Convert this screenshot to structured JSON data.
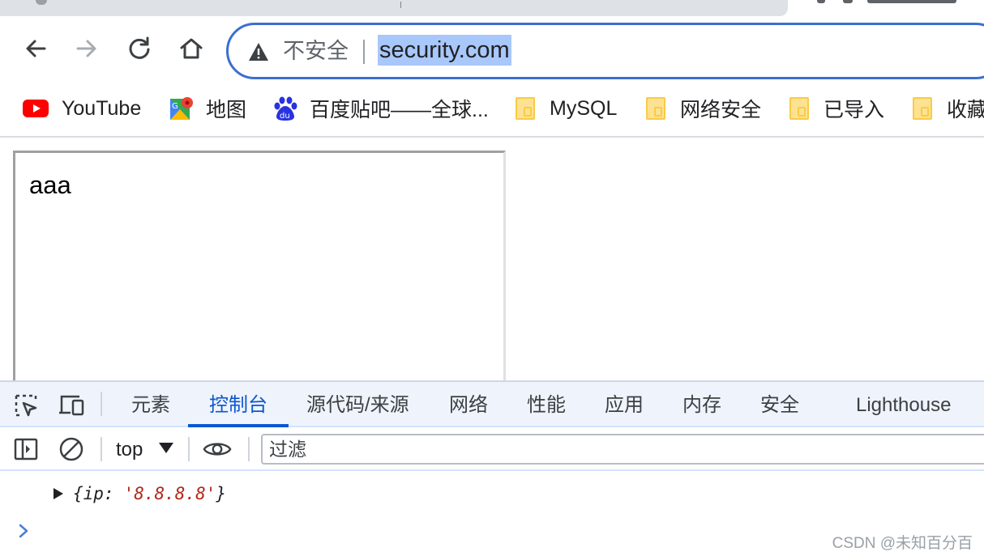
{
  "browser": {
    "address_bar": {
      "security_label": "不安全",
      "url": "security.com"
    },
    "bookmarks": [
      {
        "label": "YouTube",
        "icon": "youtube-icon"
      },
      {
        "label": "地图",
        "icon": "maps-icon"
      },
      {
        "label": "百度贴吧——全球...",
        "icon": "baidu-icon"
      },
      {
        "label": "MySQL",
        "icon": "folder-icon"
      },
      {
        "label": "网络安全",
        "icon": "folder-icon"
      },
      {
        "label": "已导入",
        "icon": "folder-icon"
      },
      {
        "label": "收藏",
        "icon": "folder-icon"
      }
    ]
  },
  "page": {
    "textarea_text": "aaa"
  },
  "devtools": {
    "tabs": [
      {
        "label": "元素"
      },
      {
        "label": "控制台",
        "active": true
      },
      {
        "label": "源代码/来源"
      },
      {
        "label": "网络"
      },
      {
        "label": "性能"
      },
      {
        "label": "应用"
      },
      {
        "label": "内存"
      },
      {
        "label": "安全"
      },
      {
        "label": "Lighthouse"
      }
    ],
    "console_toolbar": {
      "context": "top",
      "filter_placeholder": "过滤"
    },
    "console_output": {
      "open_brace": "{",
      "key": "ip:",
      "value": "'8.8.8.8'",
      "close_brace": "}"
    }
  },
  "watermark": "CSDN @未知百分百",
  "colors": {
    "accent": "#0b57d0",
    "omnibox_border": "#3c6fd0",
    "url_highlight": "#a8c7fa",
    "string_value": "#b0281a"
  }
}
